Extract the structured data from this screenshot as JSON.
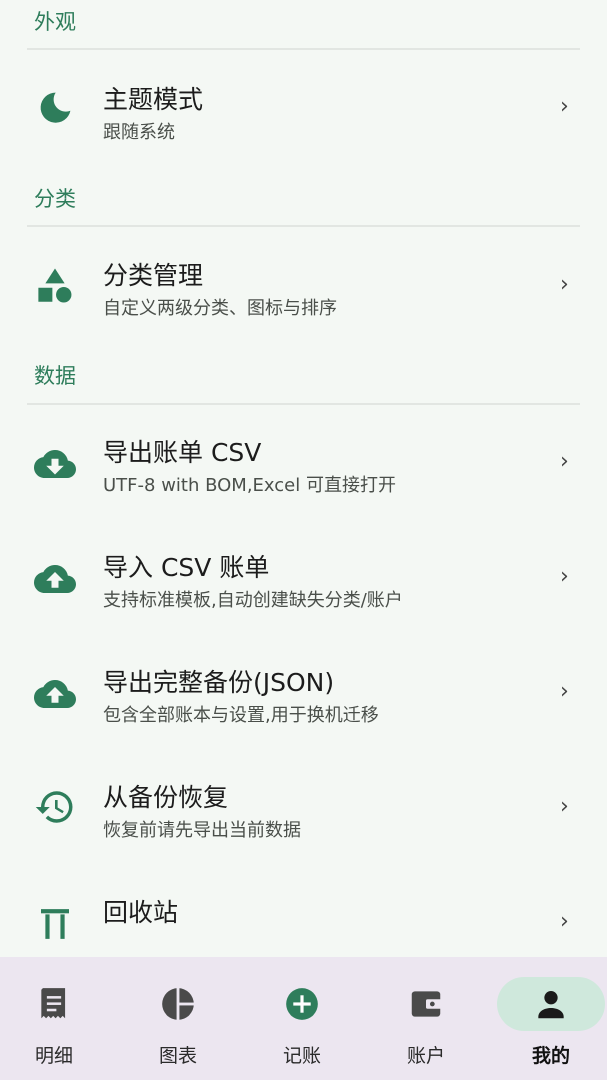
{
  "sections": {
    "appearance": "外观",
    "category": "分类",
    "data": "数据"
  },
  "rows": {
    "theme": {
      "title": "主题模式",
      "sub": "跟随系统",
      "icon": "moon-icon"
    },
    "category_manage": {
      "title": "分类管理",
      "sub": "自定义两级分类、图标与排序",
      "icon": "shapes-icon"
    },
    "export_csv": {
      "title": "导出账单 CSV",
      "sub": "UTF-8 with BOM,Excel 可直接打开",
      "icon": "cloud-download-icon"
    },
    "import_csv": {
      "title": "导入 CSV 账单",
      "sub": "支持标准模板,自动创建缺失分类/账户",
      "icon": "cloud-upload-icon"
    },
    "export_backup": {
      "title": "导出完整备份(JSON)",
      "sub": "包含全部账本与设置,用于换机迁移",
      "icon": "cloud-upload-icon"
    },
    "restore": {
      "title": "从备份恢复",
      "sub": "恢复前请先导出当前数据",
      "icon": "history-icon"
    },
    "recycle": {
      "title": "回收站",
      "sub": "",
      "icon": "trash-icon"
    }
  },
  "chevron": "›",
  "nav": {
    "details": "明细",
    "charts": "图表",
    "record": "记账",
    "accounts": "账户",
    "mine": "我的",
    "active": "mine"
  },
  "colors": {
    "accent": "#2e7d5b",
    "background": "#f4f8f4",
    "nav_background": "#ece6f0",
    "active_pill": "#cfe8dc"
  }
}
